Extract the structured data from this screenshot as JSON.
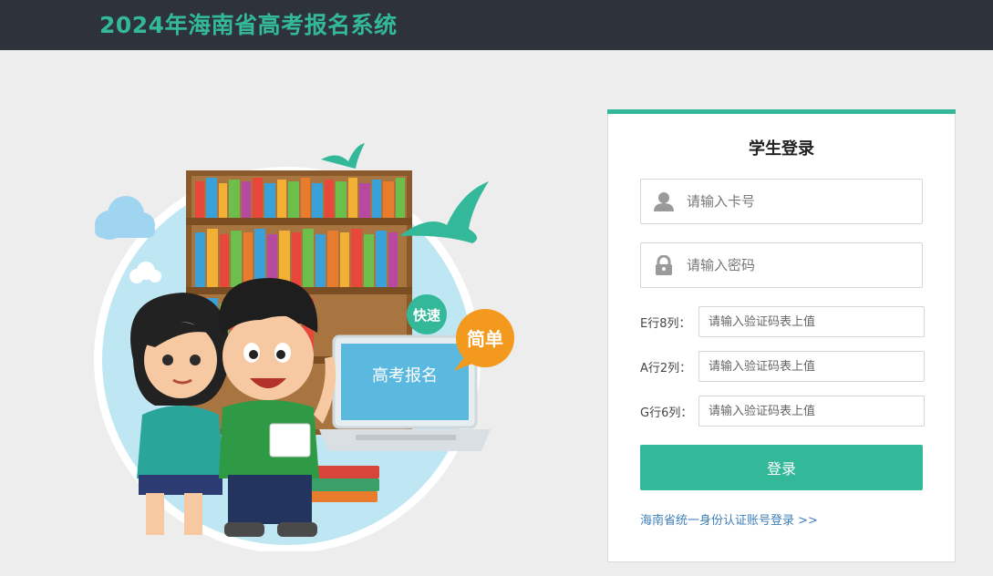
{
  "header": {
    "title": "2024年海南省高考报名系统"
  },
  "illustration": {
    "screen_text": "高考报名",
    "bubble_fast": "快速",
    "bubble_simple": "简单"
  },
  "login": {
    "title": "学生登录",
    "card_placeholder": "请输入卡号",
    "password_placeholder": "请输入密码",
    "captcha": [
      {
        "label": "E行8列：",
        "placeholder": "请输入验证码表上值"
      },
      {
        "label": "A行2列：",
        "placeholder": "请输入验证码表上值"
      },
      {
        "label": "G行6列：",
        "placeholder": "请输入验证码表上值"
      }
    ],
    "submit_label": "登录",
    "alt_login_link": "海南省统一身份认证账号登录 >>"
  },
  "colors": {
    "accent": "#33b89a",
    "header_bg": "#2e333b",
    "link": "#3f7fb8",
    "bubble_orange": "#f39a1e"
  }
}
